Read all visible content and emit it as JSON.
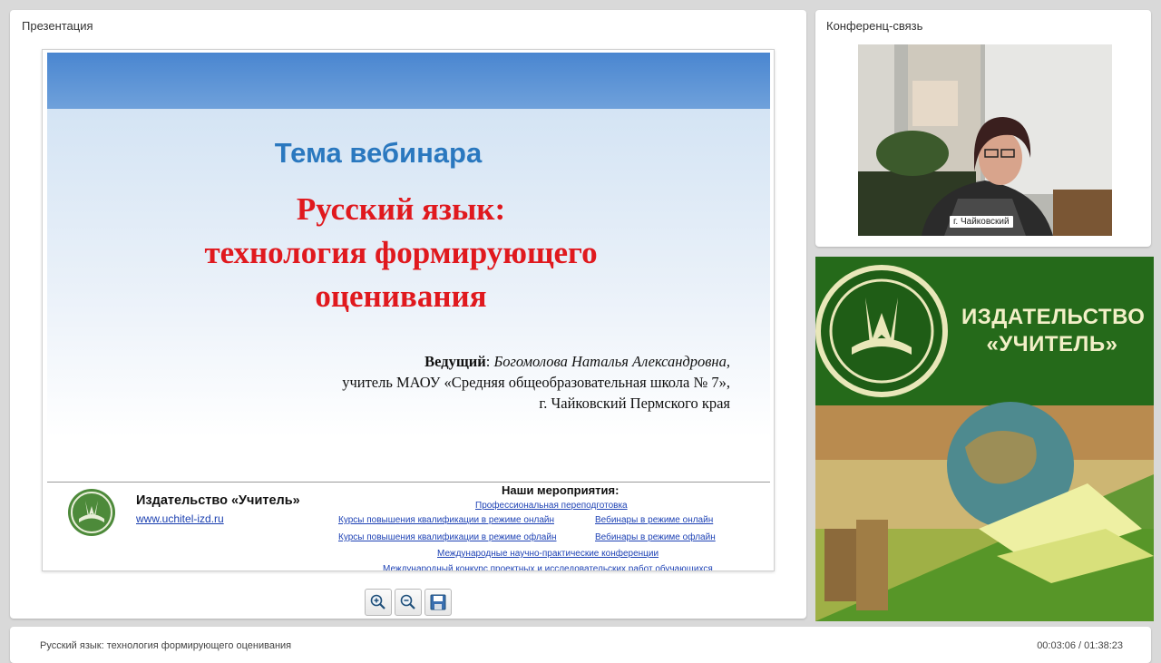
{
  "panels": {
    "presentation_title": "Презентация",
    "conference_title": "Конференц-связь"
  },
  "slide": {
    "heading": "Тема вебинара",
    "topic_line1": "Русский язык:",
    "topic_line2": "технология формирующего",
    "topic_line3": "оценивания",
    "presenter_label": "Ведущий",
    "presenter_name": "Богомолова Наталья Александровна,",
    "presenter_line2": "учитель МАОУ «Средняя общеобразовательная школа № 7»,",
    "presenter_line3": "г. Чайковский Пермского края",
    "publisher_name": "Издательство «Учитель»",
    "publisher_url": "www.uchitel-izd.ru",
    "events_title": "Наши мероприятия",
    "events": {
      "retraining": "Профессиональная переподготовка",
      "courses_online": "Курсы повышения квалификации в режиме онлайн",
      "webinars_online": "Вебинары в режиме онлайн",
      "courses_offline": "Курсы повышения квалификации в режиме офлайн",
      "webinars_offline": "Вебинары в режиме офлайн",
      "conferences": "Международные научно-практические конференции",
      "contest": "Международный конкурс проектных и исследовательских работ обучающихся"
    }
  },
  "video": {
    "location_label": "г. Чайковский"
  },
  "banner": {
    "line1": "ИЗДАТЕЛЬСТВО",
    "line2": "«УЧИТЕЛЬ»"
  },
  "footer": {
    "title": "Русский язык: технология формирующего оценивания",
    "time": "00:03:06 / 01:38:23"
  },
  "toolbar": {
    "icons": [
      "zoom-in-icon",
      "zoom-out-icon",
      "save-icon"
    ]
  },
  "colors": {
    "slide_heading": "#2a78bf",
    "slide_topic": "#e0191e",
    "banner_green": "#256a1a",
    "banner_text": "#f3f0c8"
  }
}
